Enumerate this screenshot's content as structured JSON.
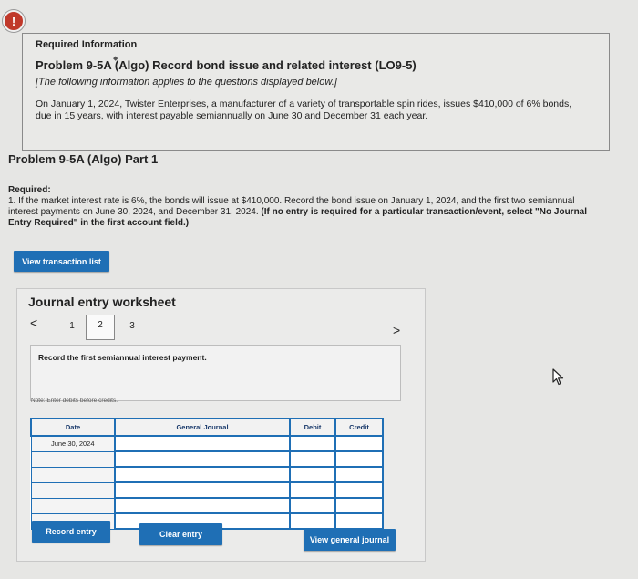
{
  "alert_icon_glyph": "!",
  "info": {
    "title": "Required Information",
    "problem": "Problem 9-5A (Algo) Record bond issue and related interest (LO9-5)",
    "note": "[The following information applies to the questions displayed below.]",
    "description": "On January 1, 2024, Twister Enterprises, a manufacturer of a variety of transportable spin rides, issues $410,000 of 6% bonds, due in 15 years, with interest payable semiannually on June 30 and December 31 each year."
  },
  "part_title": "Problem 9-5A (Algo) Part 1",
  "required": {
    "label": "Required:",
    "text": "1. If the market interest rate is 6%, the bonds will issue at $410,000. Record the bond issue on January 1, 2024, and the first two semiannual interest payments on June 30, 2024, and December 31, 2024.",
    "bold_text": "(If no entry is required for a particular transaction/event, select \"No Journal Entry Required\" in the first account field.)"
  },
  "view_transaction_list_label": "View transaction list",
  "worksheet": {
    "title": "Journal entry worksheet",
    "pages": [
      "1",
      "2",
      "3"
    ],
    "instruction": "Record the first semiannual interest payment.",
    "note": "Note: Enter debits before credits.",
    "columns": {
      "date": "Date",
      "account": "General Journal",
      "debit": "Debit",
      "credit": "Credit"
    },
    "rows": [
      {
        "date": "June 30, 2024"
      },
      {
        "date": ""
      },
      {
        "date": ""
      },
      {
        "date": ""
      },
      {
        "date": ""
      },
      {
        "date": ""
      }
    ],
    "record_label": "Record entry",
    "clear_label": "Clear entry",
    "view_journal_label": "View general journal"
  }
}
